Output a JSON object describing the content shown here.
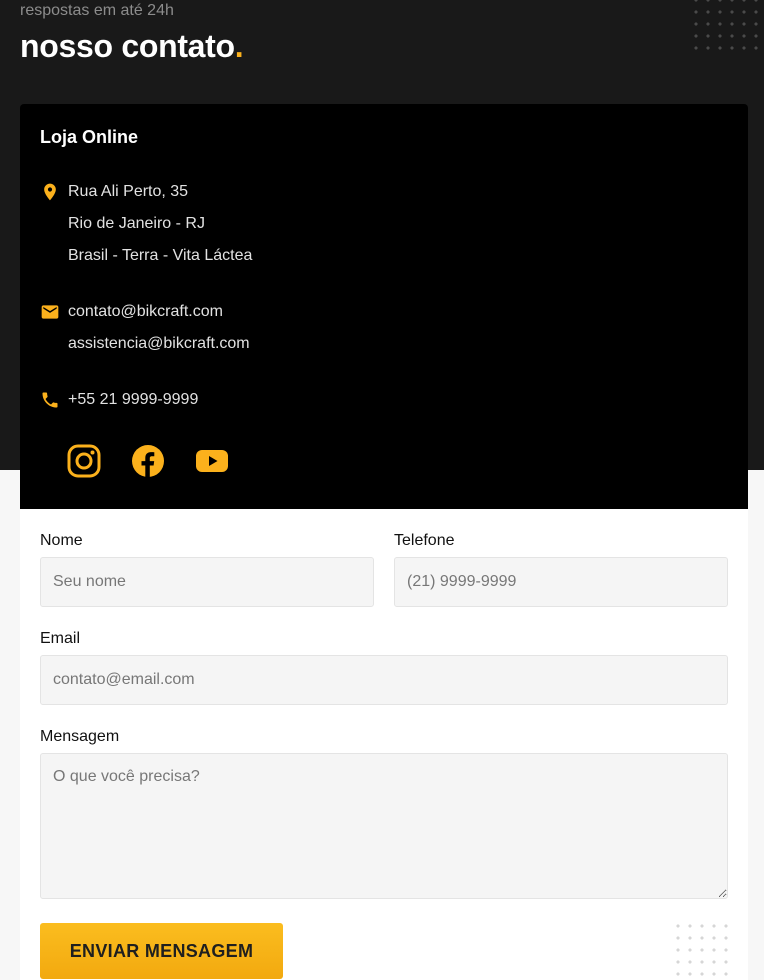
{
  "hero": {
    "subtitle": "respostas em até 24h",
    "title": "nosso contato",
    "title_accent": "."
  },
  "info": {
    "heading": "Loja Online",
    "address": [
      "Rua Ali Perto, 35",
      "Rio de Janeiro - RJ",
      "Brasil - Terra - Vita Láctea"
    ],
    "emails": [
      "contato@bikcraft.com",
      "assistencia@bikcraft.com"
    ],
    "phone": "+55 21 9999-9999",
    "icons": {
      "address": "location-pin-icon",
      "email": "envelope-icon",
      "phone": "phone-icon"
    },
    "social": [
      "instagram-icon",
      "facebook-icon",
      "youtube-icon"
    ]
  },
  "form": {
    "name_label": "Nome",
    "name_placeholder": "Seu nome",
    "phone_label": "Telefone",
    "phone_placeholder": "(21) 9999-9999",
    "email_label": "Email",
    "email_placeholder": "contato@email.com",
    "message_label": "Mensagem",
    "message_placeholder": "O que você precisa?",
    "submit_label": "ENVIAR MENSAGEM"
  },
  "colors": {
    "accent": "#fbb11c",
    "hero_background": "#191919",
    "panel_background": "#000000",
    "page_background": "#f7f7f7"
  }
}
